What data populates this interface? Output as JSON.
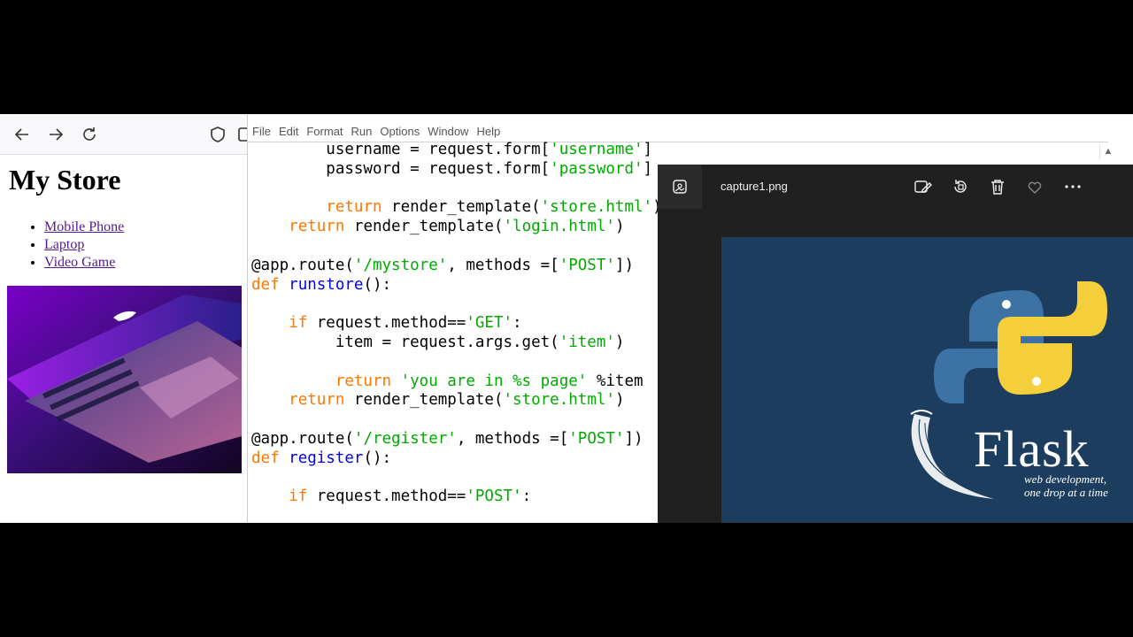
{
  "browser": {
    "page_title": "My Store",
    "products": [
      "Mobile Phone",
      "Laptop",
      "Video Game"
    ],
    "icons": [
      "back-arrow-icon",
      "forward-arrow-icon",
      "reload-icon",
      "shield-icon"
    ]
  },
  "editor": {
    "menu": [
      "File",
      "Edit",
      "Format",
      "Run",
      "Options",
      "Window",
      "Help"
    ],
    "code_lines": [
      [
        {
          "t": "        username = request.form[",
          "c": ""
        },
        {
          "t": "'username'",
          "c": "str"
        },
        {
          "t": "]",
          "c": ""
        }
      ],
      [
        {
          "t": "        password = request.form[",
          "c": ""
        },
        {
          "t": "'password'",
          "c": "str"
        },
        {
          "t": "]",
          "c": ""
        }
      ],
      [],
      [
        {
          "t": "        ",
          "c": ""
        },
        {
          "t": "return",
          "c": "kw"
        },
        {
          "t": " render_template(",
          "c": ""
        },
        {
          "t": "'store.html'",
          "c": "str"
        },
        {
          "t": ")",
          "c": ""
        }
      ],
      [
        {
          "t": "    ",
          "c": ""
        },
        {
          "t": "return",
          "c": "kw"
        },
        {
          "t": " render_template(",
          "c": ""
        },
        {
          "t": "'login.html'",
          "c": "str"
        },
        {
          "t": ")",
          "c": ""
        }
      ],
      [],
      [
        {
          "t": "@app.route(",
          "c": ""
        },
        {
          "t": "'/mystore'",
          "c": "str"
        },
        {
          "t": ", methods =[",
          "c": ""
        },
        {
          "t": "'POST'",
          "c": "str"
        },
        {
          "t": "])",
          "c": ""
        }
      ],
      [
        {
          "t": "def",
          "c": "kw"
        },
        {
          "t": " ",
          "c": ""
        },
        {
          "t": "runstore",
          "c": "def"
        },
        {
          "t": "():",
          "c": ""
        }
      ],
      [],
      [
        {
          "t": "    ",
          "c": ""
        },
        {
          "t": "if",
          "c": "kw"
        },
        {
          "t": " request.method==",
          "c": ""
        },
        {
          "t": "'GET'",
          "c": "str"
        },
        {
          "t": ":",
          "c": ""
        }
      ],
      [
        {
          "t": "         item = request.args.get(",
          "c": ""
        },
        {
          "t": "'item'",
          "c": "str"
        },
        {
          "t": ")",
          "c": ""
        }
      ],
      [],
      [
        {
          "t": "         ",
          "c": ""
        },
        {
          "t": "return",
          "c": "kw"
        },
        {
          "t": " ",
          "c": ""
        },
        {
          "t": "'you are in %s page'",
          "c": "str"
        },
        {
          "t": " %item",
          "c": ""
        }
      ],
      [
        {
          "t": "    ",
          "c": ""
        },
        {
          "t": "return",
          "c": "kw"
        },
        {
          "t": " render_template(",
          "c": ""
        },
        {
          "t": "'store.html'",
          "c": "str"
        },
        {
          "t": ")",
          "c": ""
        }
      ],
      [],
      [
        {
          "t": "@app.route(",
          "c": ""
        },
        {
          "t": "'/register'",
          "c": "str"
        },
        {
          "t": ", methods =[",
          "c": ""
        },
        {
          "t": "'POST'",
          "c": "str"
        },
        {
          "t": "])",
          "c": ""
        }
      ],
      [
        {
          "t": "def",
          "c": "kw"
        },
        {
          "t": " ",
          "c": ""
        },
        {
          "t": "register",
          "c": "def"
        },
        {
          "t": "():",
          "c": ""
        }
      ],
      [],
      [
        {
          "t": "    ",
          "c": ""
        },
        {
          "t": "if",
          "c": "kw"
        },
        {
          "t": " request.method==",
          "c": ""
        },
        {
          "t": "'POST'",
          "c": "str"
        },
        {
          "t": ":",
          "c": ""
        }
      ]
    ],
    "colors": {
      "keyword": "#ff7700",
      "string": "#00aa00",
      "definition": "#0000ff"
    }
  },
  "photos": {
    "file_name": "capture1.png",
    "image": {
      "word": "Flask",
      "tagline_1": "web development,",
      "tagline_2": "one drop at a time",
      "background": "#1c3d5e"
    },
    "icons": [
      "gallery-icon",
      "edit-image-icon",
      "rotate-icon",
      "delete-icon",
      "favorite-icon",
      "more-icon"
    ]
  }
}
